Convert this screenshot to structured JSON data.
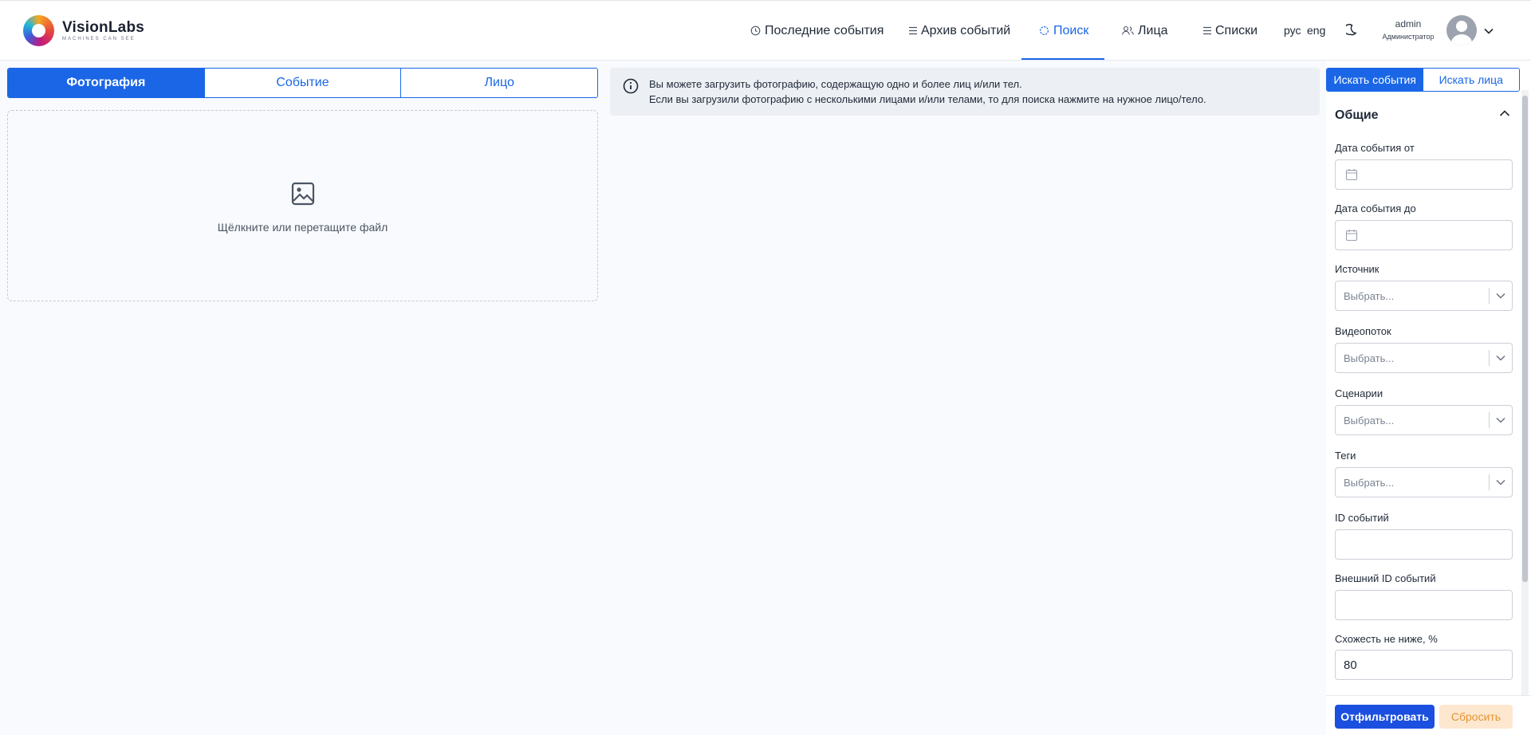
{
  "brand": {
    "name": "VisionLabs",
    "tagline": "MACHINES CAN SEE"
  },
  "nav": {
    "items": [
      {
        "label": "Последние события",
        "icon": "clock-icon"
      },
      {
        "label": "Архив событий",
        "icon": "list-icon"
      },
      {
        "label": "Поиск",
        "icon": "search-icon",
        "active": true
      },
      {
        "label": "Лица",
        "icon": "users-icon"
      },
      {
        "label": "Списки",
        "icon": "list-icon"
      }
    ],
    "lang_ru": "рус",
    "lang_en": "eng"
  },
  "user": {
    "name": "admin",
    "role": "Администратор"
  },
  "tabs": [
    {
      "label": "Фотография",
      "active": true
    },
    {
      "label": "Событие"
    },
    {
      "label": "Лицо"
    }
  ],
  "dropzone": {
    "text": "Щёлкните или перетащите файл"
  },
  "info": {
    "line1": "Вы можете загрузить фотографию, содержащую одно и более лиц и/или тел.",
    "line2": "Если вы загрузили фотографию с несколькими лицами и/или телами, то для поиска нажмите на нужное лицо/тело."
  },
  "search_mode": {
    "events": "Искать события",
    "faces": "Искать лица"
  },
  "filters": {
    "section_title": "Общие",
    "date_from": {
      "label": "Дата события от"
    },
    "date_to": {
      "label": "Дата события до"
    },
    "source": {
      "label": "Источник",
      "placeholder": "Выбрать..."
    },
    "stream": {
      "label": "Видеопоток",
      "placeholder": "Выбрать..."
    },
    "scenarios": {
      "label": "Сценарии",
      "placeholder": "Выбрать..."
    },
    "tags": {
      "label": "Теги",
      "placeholder": "Выбрать..."
    },
    "event_ids": {
      "label": "ID событий",
      "value": ""
    },
    "external_ids": {
      "label": "Внешний ID событий",
      "value": ""
    },
    "similarity": {
      "label": "Схожесть не ниже, %",
      "value": "80"
    }
  },
  "actions": {
    "filter": "Отфильтровать",
    "reset": "Сбросить"
  },
  "colors": {
    "accent": "#1a66e6",
    "reset_bg": "#fde7cf",
    "reset_text": "#e69432"
  }
}
